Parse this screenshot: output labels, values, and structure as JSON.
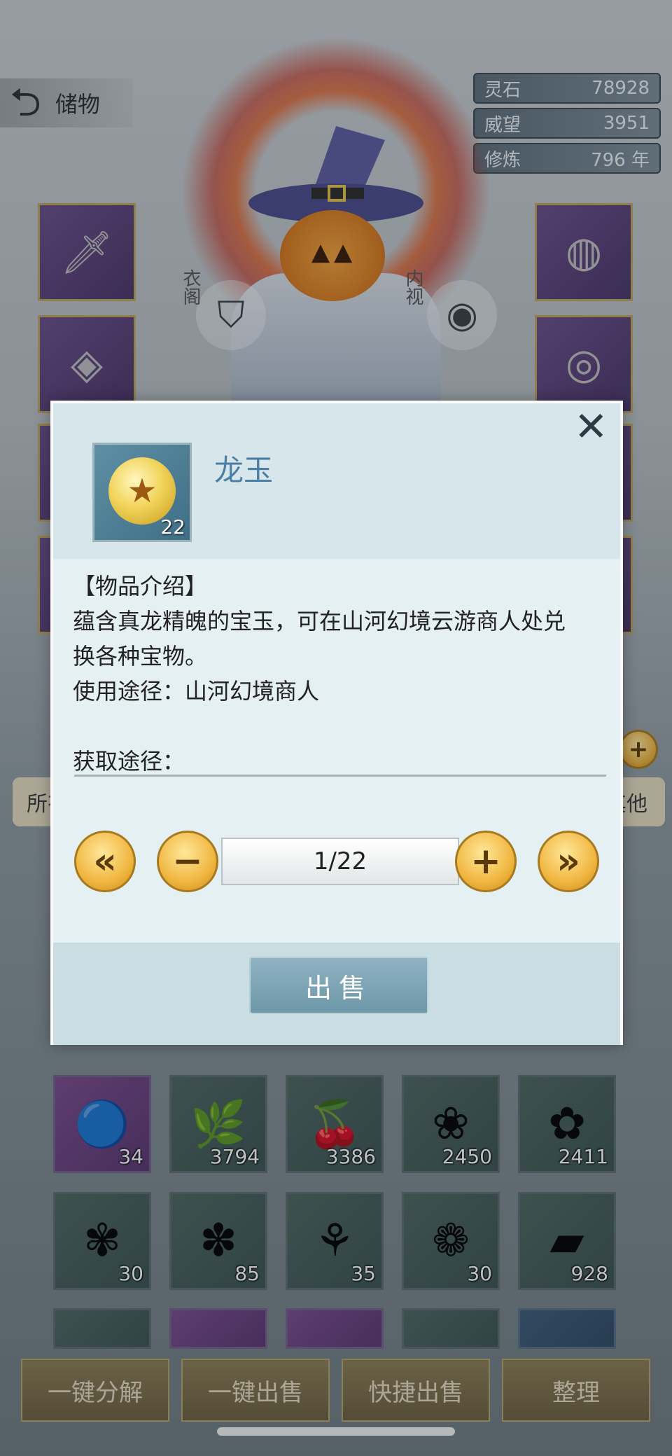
{
  "header": {
    "back_title": "储物"
  },
  "stats": [
    {
      "label": "灵石",
      "value": "78928"
    },
    {
      "label": "威望",
      "value": "3951"
    },
    {
      "label": "修炼",
      "value": "796 年"
    }
  ],
  "character": {
    "wardrobe_label": "衣阁",
    "inspect_label": "内视"
  },
  "filter_tabs": {
    "left": "所有",
    "right": "其他"
  },
  "inventory_row1": [
    {
      "count": "34",
      "icon": "blue-orb-icon"
    },
    {
      "count": "3794",
      "icon": "leaf-herb-icon"
    },
    {
      "count": "3386",
      "icon": "red-berry-icon"
    },
    {
      "count": "2450",
      "icon": "purple-flower-icon"
    },
    {
      "count": "2411",
      "icon": "pink-star-flower-icon"
    }
  ],
  "inventory_row2": [
    {
      "count": "30",
      "icon": "red-flower-icon"
    },
    {
      "count": "85",
      "icon": "white-lily-icon"
    },
    {
      "count": "35",
      "icon": "green-pod-icon"
    },
    {
      "count": "30",
      "icon": "pink-bloom-icon"
    },
    {
      "count": "928",
      "icon": "wood-block-icon"
    }
  ],
  "bottom_buttons": [
    "一键分解",
    "一键出售",
    "快捷出售",
    "整理"
  ],
  "popup": {
    "item_name": "龙玉",
    "item_count": "22",
    "intro_header": "【物品介绍】",
    "description_line1": "蕴含真龙精魄的宝玉，可在山河幻境云游商人处兑",
    "description_line2": "换各种宝物。",
    "usage": "使用途径：山河幻境商人",
    "acquire": "获取途径：",
    "quantity": "1/22",
    "sell_label": "出售"
  }
}
